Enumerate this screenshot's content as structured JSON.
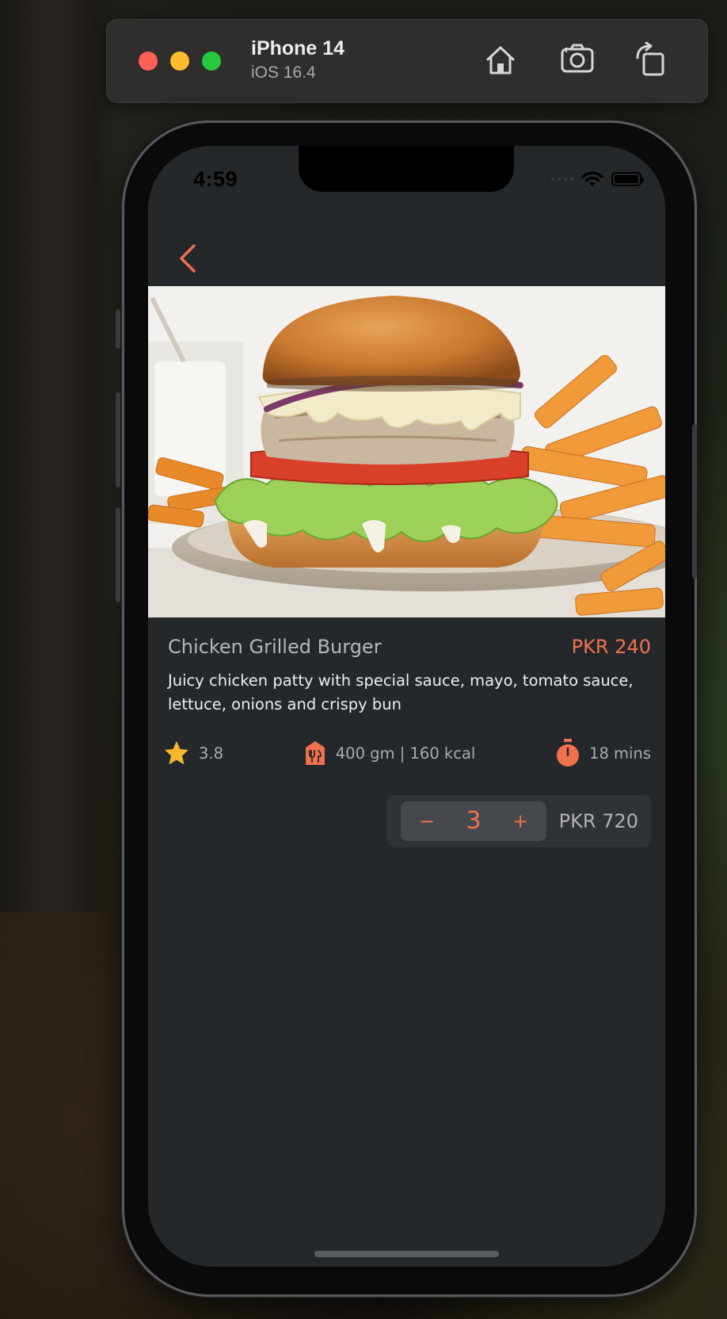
{
  "simulator": {
    "device_name": "iPhone 14",
    "os_version": "iOS 16.4",
    "icons": [
      "home-icon",
      "screenshot-icon",
      "rotate-icon"
    ]
  },
  "status_bar": {
    "time": "4:59",
    "icons": [
      "signal-dots-icon",
      "wifi-icon",
      "battery-icon"
    ]
  },
  "colors": {
    "accent": "#f0714e",
    "screen_bg": "#25282b",
    "star": "#f5b82e"
  },
  "product": {
    "name": "Chicken Grilled Burger",
    "price": "PKR 240",
    "description": "Juicy chicken patty with special sauce, mayo, tomato sauce, lettuce, onions and crispy bun",
    "rating": "3.8",
    "nutrition": "400 gm | 160 kcal",
    "prep_time": "18 mins",
    "image": "burger-with-fries-photo"
  },
  "cart": {
    "minus": "−",
    "quantity": "3",
    "plus": "+",
    "total": "PKR 720"
  }
}
